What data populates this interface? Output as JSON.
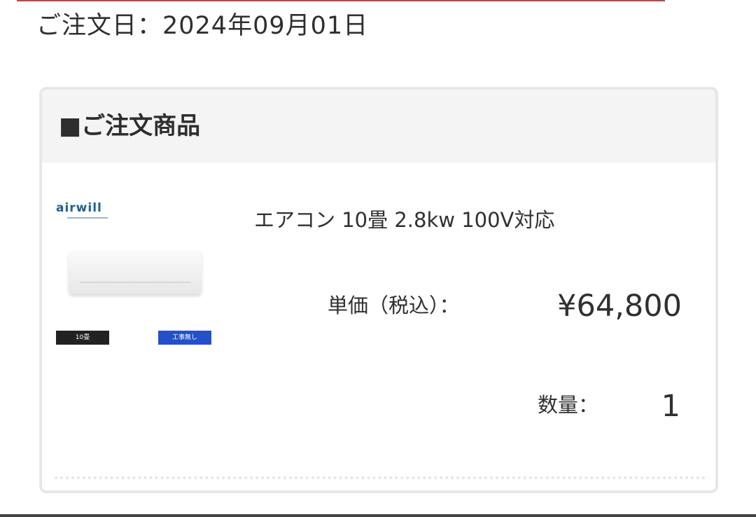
{
  "order": {
    "date_text": "ご注文日：2024年09月01日"
  },
  "ordered_items": {
    "section_title": "■ご注文商品",
    "item": {
      "image": {
        "brand": "airwill",
        "capacity_badge": "10畳",
        "service_badge": "工事無し"
      },
      "name": "エアコン 10畳 2.8kw 100V対応",
      "unit_price_label": "単価（税込）：",
      "unit_price": "¥64,800",
      "quantity_label": "数量：",
      "quantity": "1"
    }
  }
}
